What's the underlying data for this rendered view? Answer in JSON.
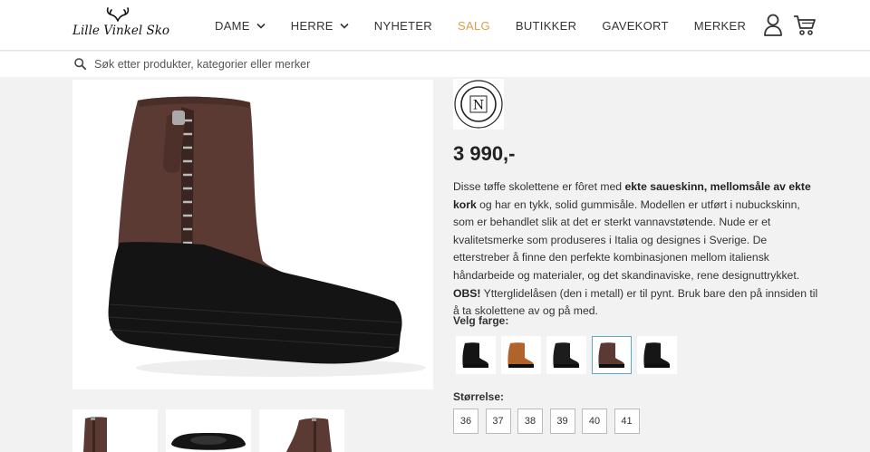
{
  "brand": {
    "wordmark": "Lille Vinkel Sko"
  },
  "nav": {
    "items": [
      {
        "label": "DAME",
        "dropdown": true,
        "sale": false
      },
      {
        "label": "HERRE",
        "dropdown": true,
        "sale": false
      },
      {
        "label": "NYHETER",
        "dropdown": false,
        "sale": false
      },
      {
        "label": "SALG",
        "dropdown": false,
        "sale": true
      },
      {
        "label": "BUTIKKER",
        "dropdown": false,
        "sale": false
      },
      {
        "label": "GAVEKORT",
        "dropdown": false,
        "sale": false
      },
      {
        "label": "MERKER",
        "dropdown": false,
        "sale": false
      }
    ]
  },
  "search": {
    "placeholder": "Søk etter produkter, kategorier eller merker",
    "value": ""
  },
  "product": {
    "brand_monogram": "N",
    "price": "3 990,-",
    "description_parts": [
      {
        "text": "Disse tøffe skolettene er fôret med ",
        "bold": false
      },
      {
        "text": "ekte saueskinn, mellomsåle av ekte kork",
        "bold": true
      },
      {
        "text": " og har en tykk, solid gummisåle. Modellen er utført i nubuckskinn, som er behandlet slik at det er sterkt vannavstøtende. Nude er et kvalitetsmerke som produseres i Italia og designes i Sverige. De etterstreber å finne den perfekte kombinasjonen mellom italiensk håndarbeide og materialer, og det skandinaviske, rene designuttrykket. ",
        "bold": false
      },
      {
        "text": "OBS!",
        "bold": true
      },
      {
        "text": " Ytterglidelåsen (den i metall) er til pynt. Bruk bare den på innsiden til å ta skolettene av og på med.",
        "bold": false
      }
    ],
    "color_label": "Velg farge:",
    "colors": [
      {
        "name": "black",
        "color": "#141414",
        "selected": false
      },
      {
        "name": "cognac",
        "color": "#b0632a",
        "selected": false
      },
      {
        "name": "black-zip",
        "color": "#1c1c1c",
        "selected": false
      },
      {
        "name": "brown",
        "color": "#5a3a33",
        "selected": true
      },
      {
        "name": "black-2",
        "color": "#161616",
        "selected": false
      }
    ],
    "size_label": "Størrelse:",
    "sizes": [
      "36",
      "37",
      "38",
      "39",
      "40",
      "41"
    ]
  },
  "colors": {
    "accent_sale": "#d4a24a",
    "selected_border": "#5aa9c8",
    "boot_brown": "#5b3a33"
  }
}
